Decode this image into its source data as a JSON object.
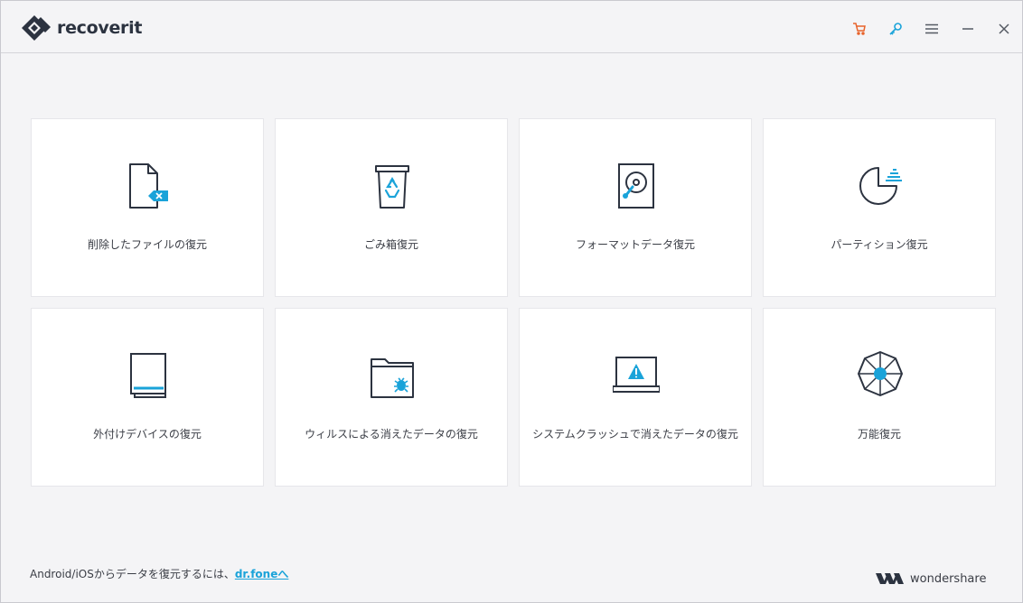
{
  "app": {
    "name": "recoverit",
    "brand": "wondershare"
  },
  "titlebar": {
    "buttons": [
      {
        "name": "cart-icon",
        "color": "#e8632b"
      },
      {
        "name": "key-icon",
        "color": "#1aa3d9"
      },
      {
        "name": "menu-icon",
        "color": "#555a63"
      },
      {
        "name": "minimize-icon",
        "color": "#555a63"
      },
      {
        "name": "close-icon",
        "color": "#555a63"
      }
    ]
  },
  "modes": [
    {
      "label": "削除したファイルの復元",
      "icon": "deleted-file-icon"
    },
    {
      "label": "ごみ箱復元",
      "icon": "recycle-bin-icon"
    },
    {
      "label": "フォーマットデータ復元",
      "icon": "hard-drive-icon"
    },
    {
      "label": "パーティション復元",
      "icon": "partition-icon"
    },
    {
      "label": "外付けデバイスの復元",
      "icon": "external-device-icon"
    },
    {
      "label": "ウィルスによる消えたデータの復元",
      "icon": "virus-folder-icon"
    },
    {
      "label": "システムクラッシュで消えたデータの復元",
      "icon": "system-crash-icon"
    },
    {
      "label": "万能復元",
      "icon": "all-round-icon"
    }
  ],
  "footer": {
    "prefix": "Android/iOSからデータを復元するには、",
    "link": "dr.foneへ"
  },
  "colors": {
    "accent": "#1aa3d9",
    "dark": "#2c3340",
    "cart": "#e8632b"
  }
}
